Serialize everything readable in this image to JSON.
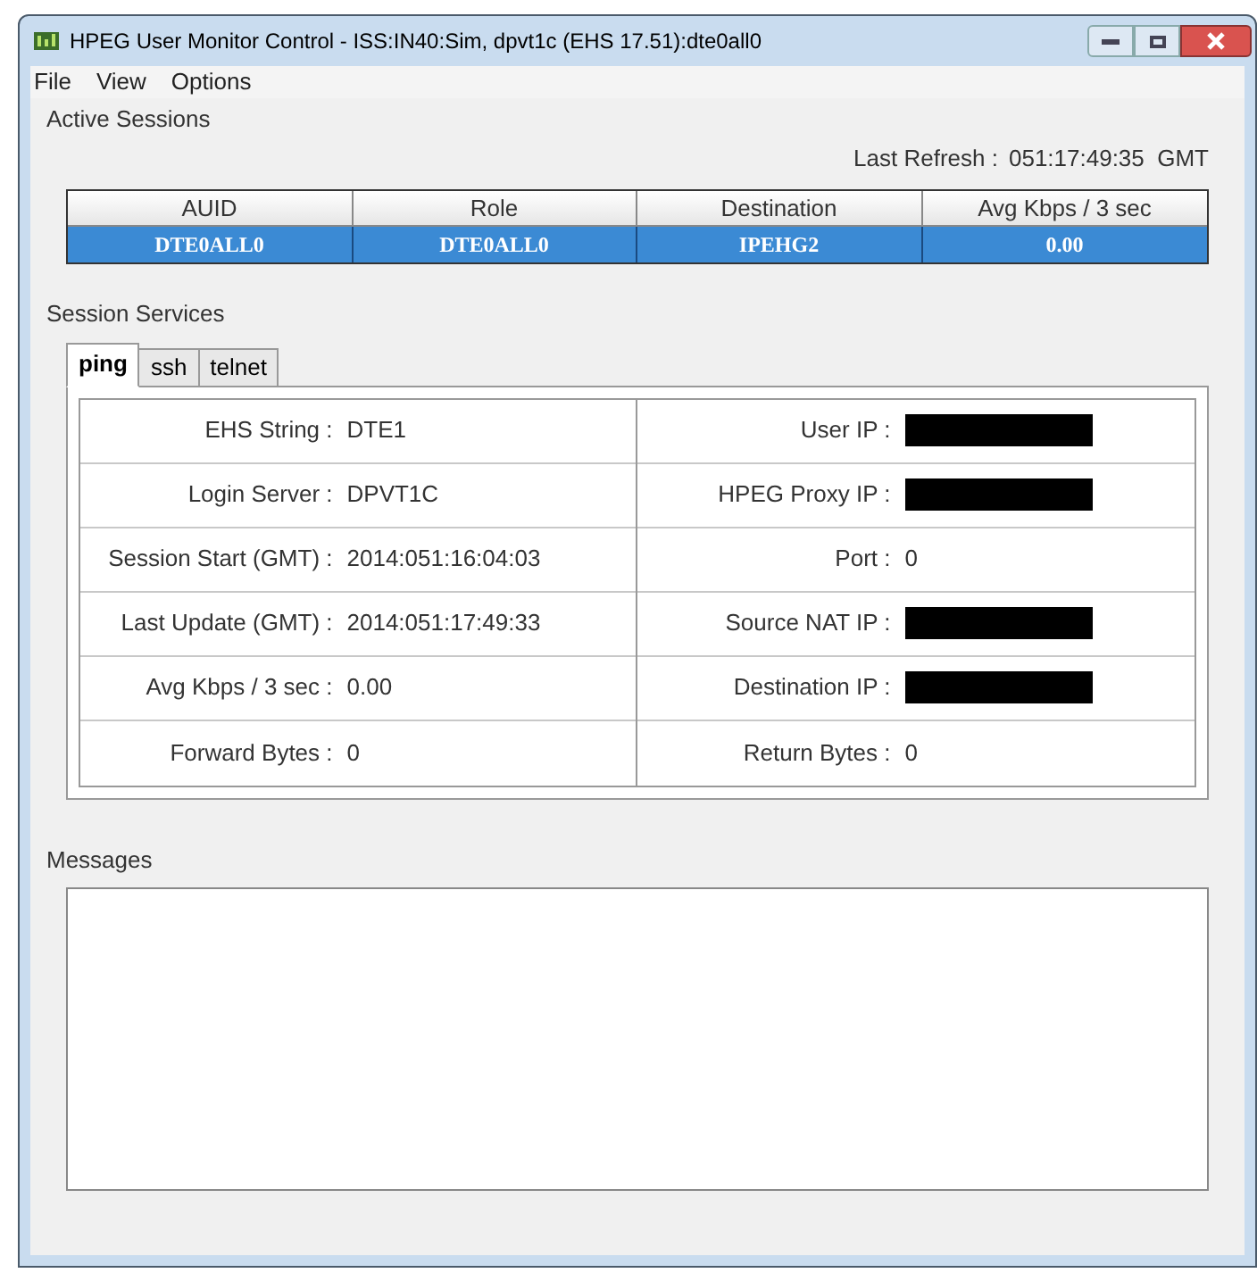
{
  "window": {
    "title": "HPEG User Monitor Control - ISS:IN40:Sim, dpvt1c (EHS 17.51):dte0all0"
  },
  "menu": [
    "File",
    "View",
    "Options"
  ],
  "active_sessions": {
    "title": "Active Sessions",
    "last_refresh_label": "Last Refresh :",
    "last_refresh_value": "051:17:49:35  GMT",
    "table": {
      "columns": [
        "AUID",
        "Role",
        "Destination",
        "Avg Kbps / 3 sec"
      ],
      "rows": [
        {
          "cells": [
            "DTE0ALL0",
            "DTE0ALL0",
            "IPEHG2",
            "0.00"
          ],
          "selected": true
        }
      ]
    }
  },
  "session_services": {
    "title": "Session Services",
    "tabs": [
      {
        "label": "ping",
        "selected": true
      },
      {
        "label": "ssh",
        "selected": false
      },
      {
        "label": "telnet",
        "selected": false
      }
    ],
    "rows": [
      [
        {
          "label": "EHS String :",
          "value": "DTE1",
          "redacted": false
        },
        {
          "label": "User IP :",
          "redacted": true
        }
      ],
      [
        {
          "label": "Login Server :",
          "value": "DPVT1C",
          "redacted": false
        },
        {
          "label": "HPEG Proxy IP :",
          "redacted": true
        }
      ],
      [
        {
          "label": "Session Start (GMT) :",
          "value": "2014:051:16:04:03",
          "redacted": false
        },
        {
          "label": "Port :",
          "value": "0",
          "redacted": false
        }
      ],
      [
        {
          "label": "Last Update (GMT) :",
          "value": "2014:051:17:49:33",
          "redacted": false
        },
        {
          "label": "Source NAT IP :",
          "redacted": true
        }
      ],
      [
        {
          "label": "Avg Kbps / 3 sec :",
          "value": "0.00",
          "redacted": false
        },
        {
          "label": "Destination IP :",
          "redacted": true
        }
      ],
      [
        {
          "label": "Forward Bytes :",
          "value": "0",
          "redacted": false
        },
        {
          "label": "Return Bytes :",
          "value": "0",
          "redacted": false
        }
      ]
    ]
  },
  "messages": {
    "title": "Messages"
  }
}
